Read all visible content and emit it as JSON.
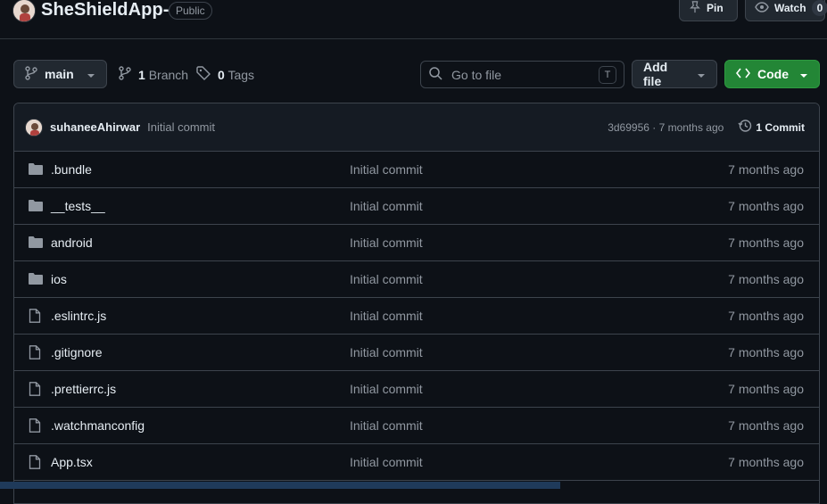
{
  "repo": {
    "name": "SheShieldApp-",
    "visibility": "Public",
    "pin_label": "Pin",
    "watch_label": "Watch",
    "watch_count": "0"
  },
  "toolbar": {
    "branch": "main",
    "branches_count": "1",
    "branches_label": "Branch",
    "tags_count": "0",
    "tags_label": "Tags",
    "search_placeholder": "Go to file",
    "search_shortcut": "T",
    "add_file_label": "Add file",
    "code_label": "Code"
  },
  "latest_commit": {
    "author": "suhaneeAhirwar",
    "message": "Initial commit",
    "sha_and_age": "3d69956 · 7 months ago",
    "commit_count": "1 Commit"
  },
  "files": [
    {
      "name": ".bundle",
      "type": "folder",
      "commit": "Initial commit",
      "age": "7 months ago"
    },
    {
      "name": "__tests__",
      "type": "folder",
      "commit": "Initial commit",
      "age": "7 months ago"
    },
    {
      "name": "android",
      "type": "folder",
      "commit": "Initial commit",
      "age": "7 months ago"
    },
    {
      "name": "ios",
      "type": "folder",
      "commit": "Initial commit",
      "age": "7 months ago"
    },
    {
      "name": ".eslintrc.js",
      "type": "file",
      "commit": "Initial commit",
      "age": "7 months ago"
    },
    {
      "name": ".gitignore",
      "type": "file",
      "commit": "Initial commit",
      "age": "7 months ago"
    },
    {
      "name": ".prettierrc.js",
      "type": "file",
      "commit": "Initial commit",
      "age": "7 months ago"
    },
    {
      "name": ".watchmanconfig",
      "type": "file",
      "commit": "Initial commit",
      "age": "7 months ago"
    },
    {
      "name": "App.tsx",
      "type": "file",
      "commit": "Initial commit",
      "age": "7 months ago"
    }
  ],
  "colors": {
    "background": "#0d1117",
    "border": "#3d444d",
    "code_button": "#238636",
    "muted_text": "#9198a1"
  }
}
